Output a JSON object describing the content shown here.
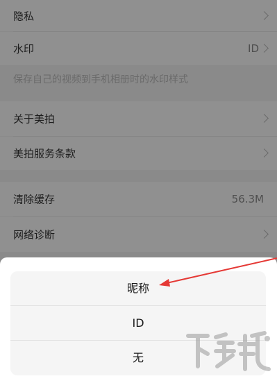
{
  "settings": {
    "privacy": {
      "label": "隐私"
    },
    "watermark": {
      "label": "水印",
      "value": "ID"
    },
    "watermark_note": "保存自己的视频到手机相册时的水印样式",
    "about": {
      "label": "关于美拍"
    },
    "terms": {
      "label": "美拍服务条款"
    },
    "clear_cache": {
      "label": "清除缓存",
      "value": "56.3M"
    },
    "network": {
      "label": "网络诊断"
    }
  },
  "sheet": {
    "options": [
      "昵称",
      "ID",
      "无"
    ]
  },
  "annotation": {
    "arrow_color": "#e53935"
  },
  "site_watermark": {
    "text": "下载吧"
  },
  "colors": {
    "overlay": "#8a8a8a",
    "sheet_bg": "#ffffff",
    "option_bg": "#f5f5f5"
  }
}
